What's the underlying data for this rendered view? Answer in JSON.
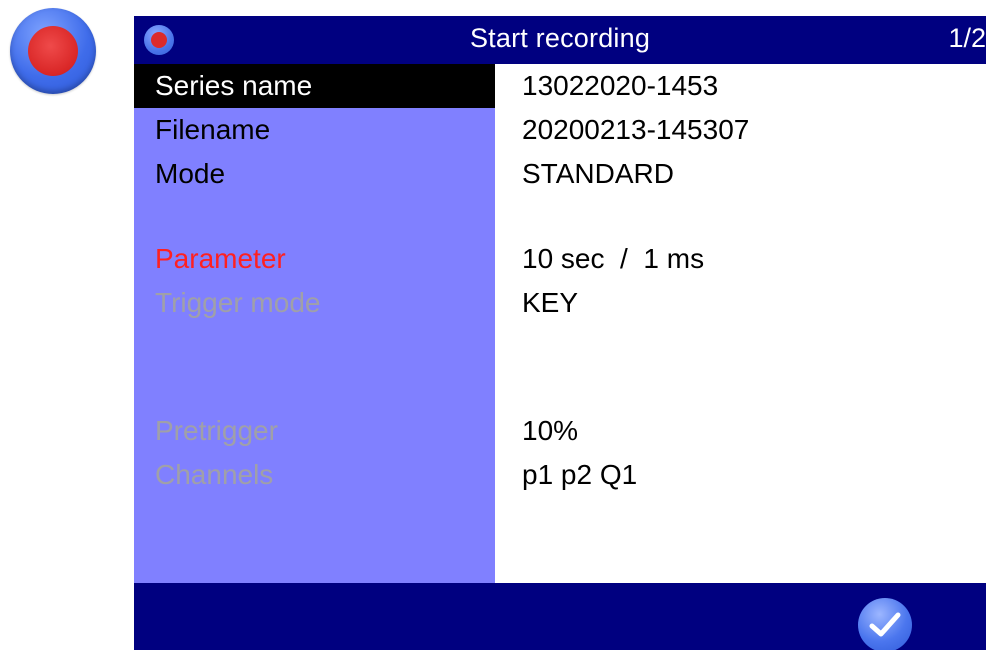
{
  "header": {
    "title": "Start recording",
    "page_indicator": "1/2"
  },
  "icons": {
    "record": "record-icon",
    "confirm": "checkmark-icon"
  },
  "colors": {
    "title_bar": "#000080",
    "label_column": "#8080ff",
    "selected_row": "#000000",
    "highlight_label": "#ff2020",
    "disabled_label": "#a0a0a8",
    "record_dot": "#d92626",
    "button_blue": "#4b76ee"
  },
  "rows": [
    {
      "label": "Series name",
      "value": "13022020-1453",
      "state": "selected"
    },
    {
      "label": "Filename",
      "value": "20200213-145307",
      "state": "normal"
    },
    {
      "label": "Mode",
      "value": "STANDARD",
      "state": "normal"
    },
    {
      "label": "Parameter",
      "value": "10 sec  /  1 ms",
      "state": "highlight"
    },
    {
      "label": "Trigger mode",
      "value": "KEY",
      "state": "disabled"
    },
    {
      "label": "Pretrigger",
      "value": "10%",
      "state": "disabled"
    },
    {
      "label": "Channels",
      "value": "p1 p2 Q1",
      "state": "disabled"
    }
  ]
}
